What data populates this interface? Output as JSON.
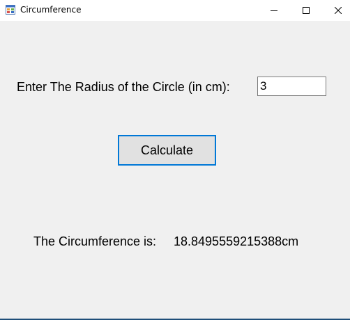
{
  "window": {
    "title": "Circumference",
    "icon": "windows-form-icon",
    "controls": [
      "minimize-icon",
      "maximize-icon",
      "close-icon"
    ]
  },
  "form": {
    "radius_label": "Enter The Radius of the Circle (in cm):",
    "radius_value": "3",
    "calculate_label": "Calculate",
    "result_label": "The Circumference is:",
    "result_value": "18.8495559215388cm"
  },
  "colors": {
    "background": "#f0f0f0",
    "titlebar": "#ffffff",
    "button_border": "#0078d7",
    "button_fill": "#e1e1e1"
  }
}
